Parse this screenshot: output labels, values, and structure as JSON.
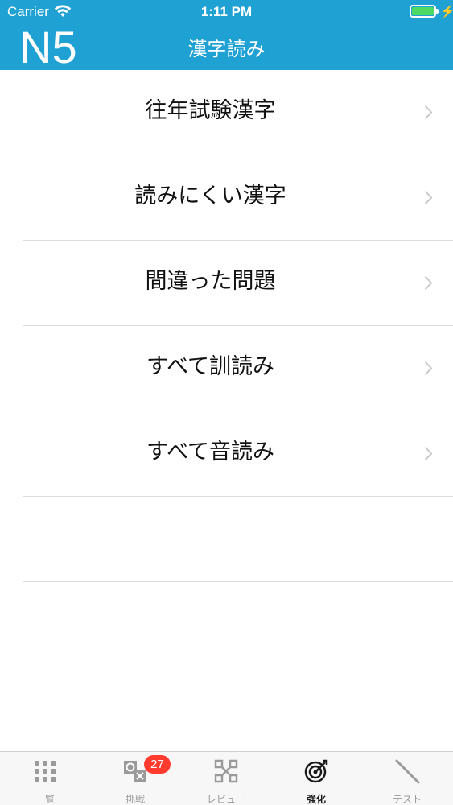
{
  "status_bar": {
    "carrier": "Carrier",
    "time": "1:11 PM",
    "battery_color": "#4cd964"
  },
  "header": {
    "level": "N5",
    "title": "漢字読み",
    "background_color": "#1fa1d4"
  },
  "menu": {
    "items": [
      {
        "label": "往年試験漢字",
        "icon": "chevron-right-icon"
      },
      {
        "label": "読みにくい漢字",
        "icon": "chevron-right-icon"
      },
      {
        "label": "間違った問題",
        "icon": "chevron-right-icon"
      },
      {
        "label": "すべて訓読み",
        "icon": "chevron-right-icon"
      },
      {
        "label": "すべて音読み",
        "icon": "chevron-right-icon"
      }
    ],
    "empty_rows": 3
  },
  "tab_bar": {
    "tabs": [
      {
        "label": "一覧",
        "icon": "grid-icon",
        "active": false
      },
      {
        "label": "挑戦",
        "icon": "circle-cross-icon",
        "active": false,
        "badge": "27"
      },
      {
        "label": "レビュー",
        "icon": "review-icon",
        "active": false
      },
      {
        "label": "強化",
        "icon": "target-icon",
        "active": true
      },
      {
        "label": "テスト",
        "icon": "pencil-icon",
        "active": false
      }
    ],
    "badge_color": "#ff3b30"
  }
}
